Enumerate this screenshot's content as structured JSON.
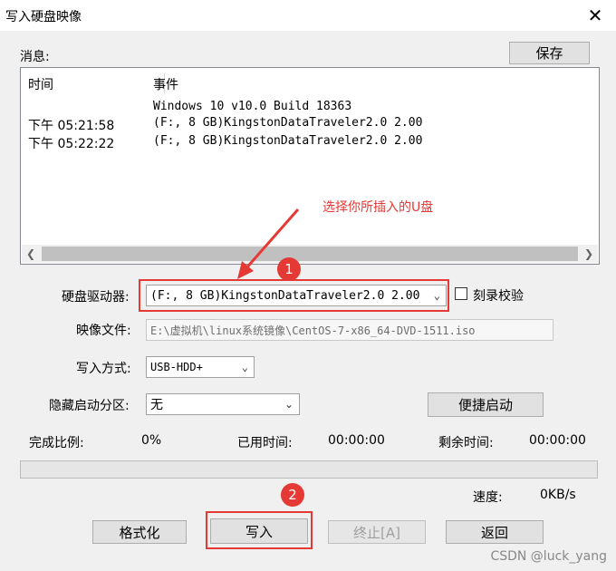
{
  "window": {
    "title": "写入硬盘映像",
    "close_glyph": "✕"
  },
  "messages": {
    "label": "消息:",
    "save_button": "保存",
    "columns": {
      "time": "时间",
      "event": "事件"
    },
    "rows": [
      {
        "time": "",
        "event": "Windows 10 v10.0 Build 18363"
      },
      {
        "time": "下午 05:21:58",
        "event": "(F:, 8 GB)KingstonDataTraveler2.0 2.00"
      },
      {
        "time": "下午 05:22:22",
        "event": "(F:, 8 GB)KingstonDataTraveler2.0 2.00"
      }
    ]
  },
  "annotation": {
    "note": "选择你所插入的U盘",
    "badge1": "1",
    "badge2": "2",
    "color": "#e53935"
  },
  "form": {
    "drive_label": "硬盘驱动器:",
    "drive_value": "(F:, 8 GB)KingstonDataTraveler2.0 2.00",
    "verify_label": "刻录校验",
    "verify_checked": false,
    "image_label": "映像文件:",
    "image_value": "E:\\虚拟机\\linux系统镜像\\CentOS-7-x86_64-DVD-1511.iso",
    "method_label": "写入方式:",
    "method_value": "USB-HDD+",
    "hidden_label": "隐藏启动分区:",
    "hidden_value": "无",
    "quickboot_button": "便捷启动"
  },
  "status": {
    "complete_label": "完成比例:",
    "complete_value": "0%",
    "elapsed_label": "已用时间:",
    "elapsed_value": "00:00:00",
    "remaining_label": "剩余时间:",
    "remaining_value": "00:00:00",
    "speed_label": "速度:",
    "speed_value": "0KB/s",
    "progress_fraction": 0
  },
  "actions": {
    "format": "格式化",
    "write": "写入",
    "stop": "终止[A]",
    "back": "返回"
  },
  "watermark": "CSDN @luck_yang"
}
